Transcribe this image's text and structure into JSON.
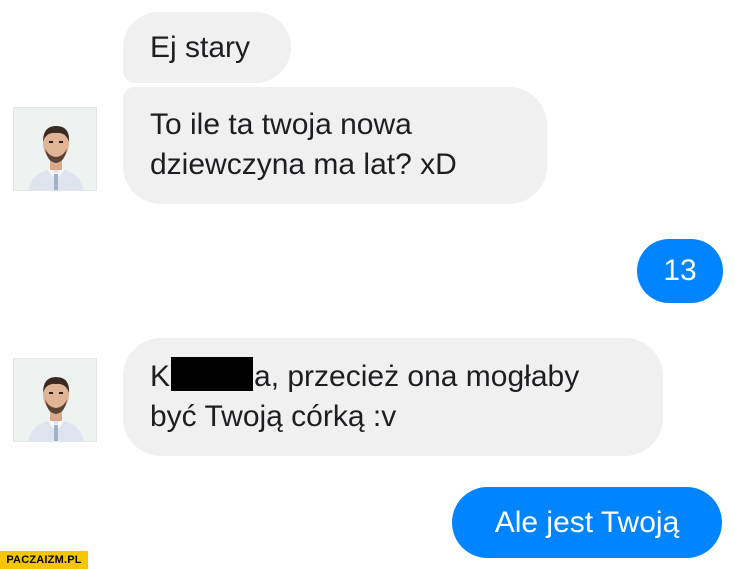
{
  "messages": [
    {
      "side": "incoming",
      "text": "Ej stary"
    },
    {
      "side": "incoming",
      "line1": "To ile ta twoja nowa",
      "line2": "dziewczyna ma lat? xD"
    },
    {
      "side": "outgoing",
      "text": "13"
    },
    {
      "side": "incoming",
      "line1_start": "K",
      "line1_end": "a, przecież ona mogłaby",
      "line2": "być Twoją córką :v",
      "redacted": true
    },
    {
      "side": "outgoing",
      "text": "Ale jest Twoją"
    }
  ],
  "colors": {
    "incoming_bubble": "#f1f0f0",
    "outgoing_bubble": "#0084ff",
    "watermark_bg": "#f5c600"
  },
  "watermark": "PACZAIZM.PL"
}
